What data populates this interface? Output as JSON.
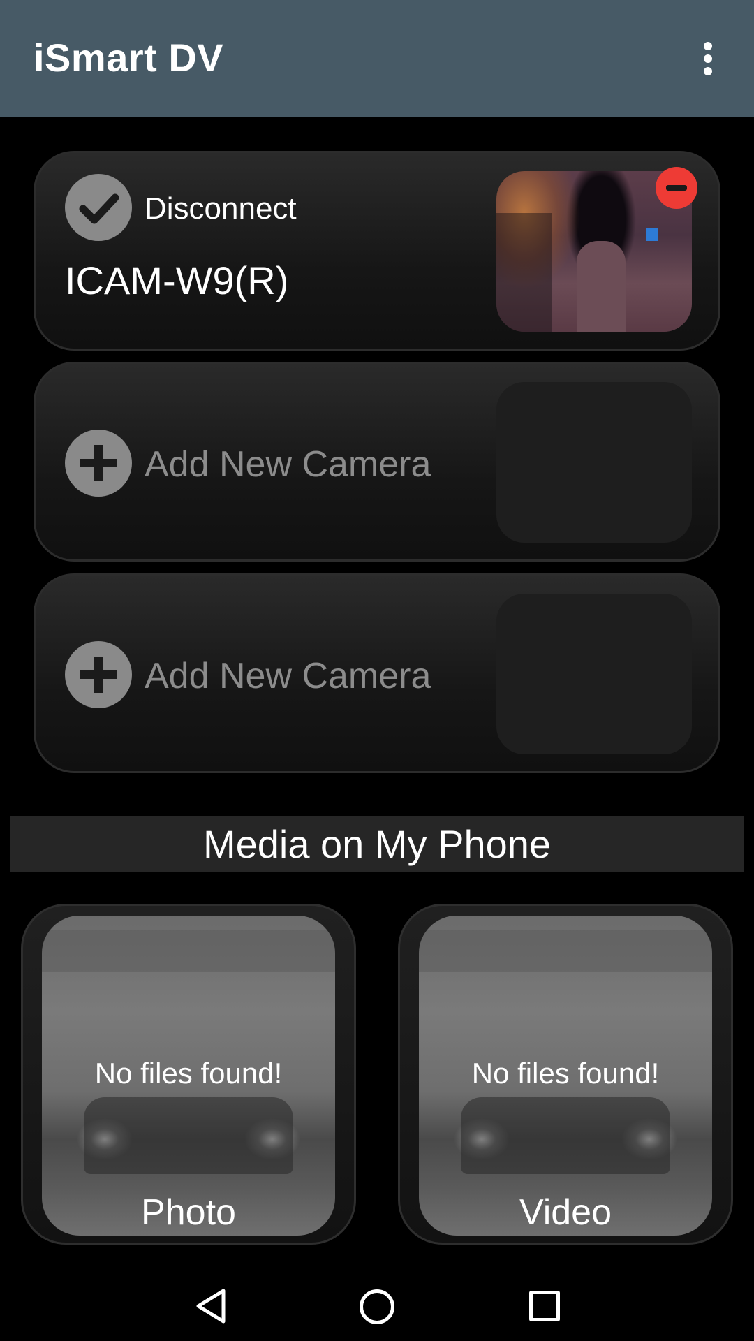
{
  "app_bar": {
    "title": "iSmart DV",
    "menu_icon": "more-vert-icon"
  },
  "cameras": [
    {
      "status_icon": "check-circle-icon",
      "status_label": "Disconnect",
      "name": "ICAM-W9(R)",
      "has_preview": true,
      "remove_icon": "remove-circle-icon"
    },
    {
      "add_icon": "add-circle-icon",
      "label": "Add New Camera"
    },
    {
      "add_icon": "add-circle-icon",
      "label": "Add New Camera"
    }
  ],
  "media_section": {
    "title": "Media on My Phone",
    "tiles": [
      {
        "label": "Photo",
        "message": "No files found!"
      },
      {
        "label": "Video",
        "message": "No files found!"
      }
    ]
  },
  "nav_bar": {
    "back_icon": "back-triangle-icon",
    "home_icon": "home-circle-icon",
    "recents_icon": "recents-square-icon"
  },
  "colors": {
    "app_bar": "#475a66",
    "background": "#000000",
    "remove_badge": "#ee3b35",
    "icon_gray": "#8a8a8a"
  }
}
